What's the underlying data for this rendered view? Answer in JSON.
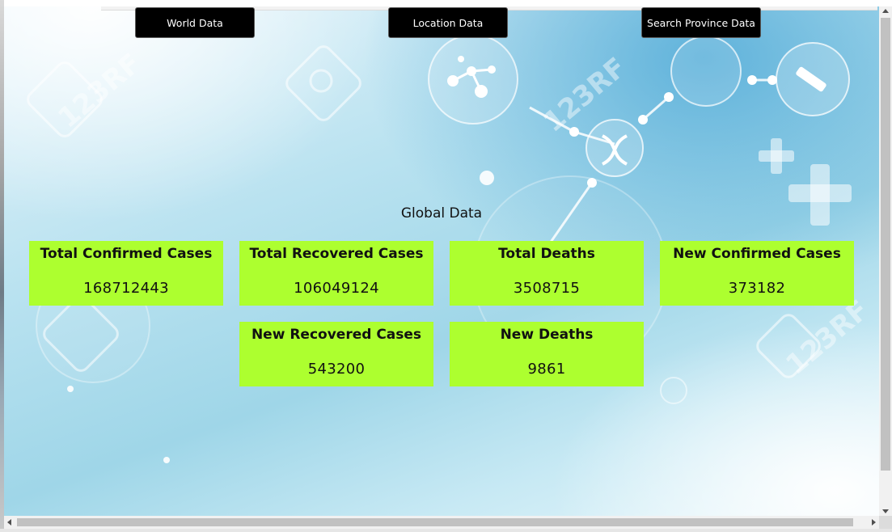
{
  "nav": {
    "world_data": "World Data",
    "location_data": "Location Data",
    "search_province_data": "Search Province Data"
  },
  "global": {
    "title": "Global Data",
    "cards": [
      {
        "label": "Total Confirmed Cases",
        "value": "168712443"
      },
      {
        "label": "Total Recovered Cases",
        "value": "106049124"
      },
      {
        "label": "Total Deaths",
        "value": "3508715"
      },
      {
        "label": "New Confirmed Cases",
        "value": "373182"
      },
      {
        "label": "New Recovered Cases",
        "value": "543200"
      },
      {
        "label": "New Deaths",
        "value": "9861"
      }
    ]
  },
  "background": {
    "watermark": "123RF"
  },
  "colors": {
    "card_bg": "#adff2f",
    "nav_bg": "#000000",
    "nav_text": "#ffffff"
  },
  "icons": [
    "molecule-icon",
    "dna-icon",
    "syringe-icon",
    "medical-cross-icon",
    "watermark-face-icon"
  ]
}
